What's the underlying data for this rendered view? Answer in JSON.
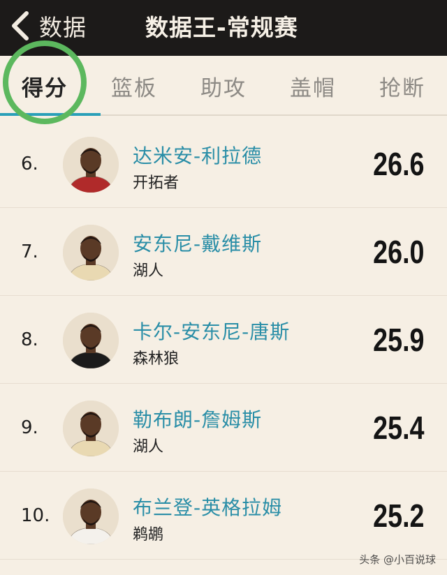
{
  "header": {
    "back_label": "数据",
    "title": "数据王-常规赛"
  },
  "tabs": [
    {
      "label": "得分",
      "active": true
    },
    {
      "label": "篮板",
      "active": false
    },
    {
      "label": "助攻",
      "active": false
    },
    {
      "label": "盖帽",
      "active": false
    },
    {
      "label": "抢断",
      "active": false
    }
  ],
  "players": [
    {
      "rank": "6.",
      "name": "达米安-利拉德",
      "team": "开拓者",
      "value": "26.6",
      "jersey": "#b02a2a"
    },
    {
      "rank": "7.",
      "name": "安东尼-戴维斯",
      "team": "湖人",
      "value": "26.0",
      "jersey": "#e9d9b2"
    },
    {
      "rank": "8.",
      "name": "卡尔-安东尼-唐斯",
      "team": "森林狼",
      "value": "25.9",
      "jersey": "#1b1b1b"
    },
    {
      "rank": "9.",
      "name": "勒布朗-詹姆斯",
      "team": "湖人",
      "value": "25.4",
      "jersey": "#e9d9b2"
    },
    {
      "rank": "10.",
      "name": "布兰登-英格拉姆",
      "team": "鹈鹕",
      "value": "25.2",
      "jersey": "#f4f1ec"
    }
  ],
  "watermark": "头条 @小百说球",
  "colors": {
    "accent": "#2a9fb8",
    "name": "#2a8ea7",
    "background": "#f6efe4",
    "header": "#1c1a19",
    "circle": "#5cb85e"
  }
}
